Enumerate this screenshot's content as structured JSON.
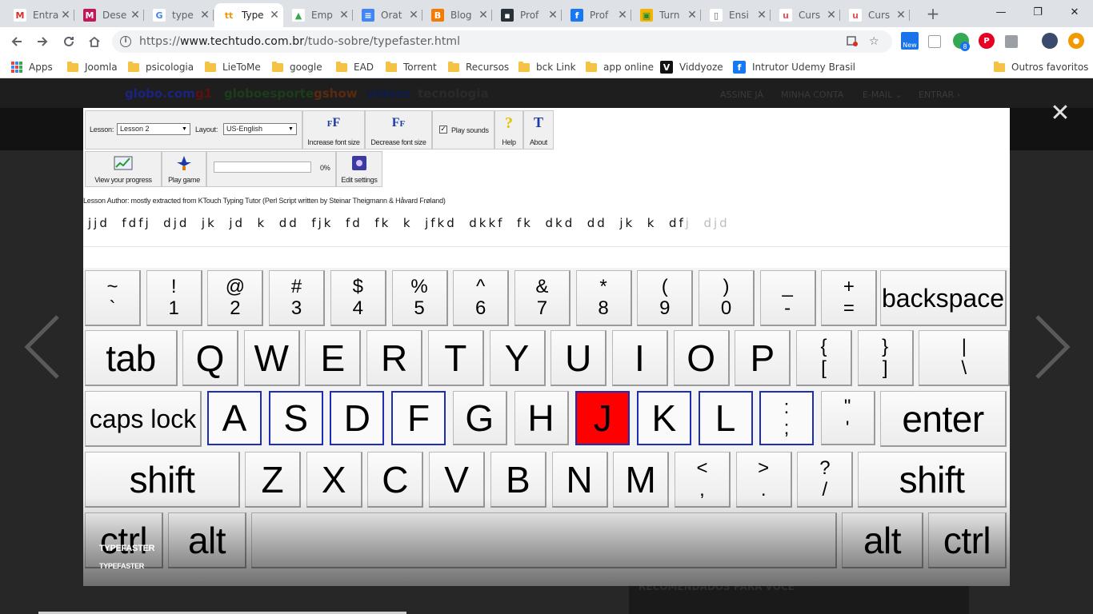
{
  "browser": {
    "tabs": [
      {
        "title": "Entra",
        "icon": "gmail-icon",
        "favicon_text": "M",
        "color": "#ffffff",
        "fg": "#d93025"
      },
      {
        "title": "Dese",
        "icon": "mendeley-icon",
        "favicon_text": "M",
        "color": "#c2185b",
        "fg": "#ffffff"
      },
      {
        "title": "type",
        "icon": "google-icon",
        "favicon_text": "G",
        "color": "#ffffff",
        "fg": "#4285f4"
      },
      {
        "title": "Type",
        "icon": "techtudo-icon",
        "favicon_text": "tt",
        "color": "#ffffff",
        "fg": "#f29900",
        "active": true
      },
      {
        "title": "Emp",
        "icon": "drive-icon",
        "favicon_text": "▲",
        "color": "#ffffff",
        "fg": "#34a853"
      },
      {
        "title": "Orat",
        "icon": "docs-icon",
        "favicon_text": "≡",
        "color": "#4285f4",
        "fg": "#ffffff"
      },
      {
        "title": "Blog",
        "icon": "blogger-icon",
        "favicon_text": "B",
        "color": "#f57c00",
        "fg": "#ffffff"
      },
      {
        "title": "Prof",
        "icon": "classroom-board-icon",
        "favicon_text": "▪",
        "color": "#263238",
        "fg": "#ffffff"
      },
      {
        "title": "Prof",
        "icon": "facebook-icon",
        "favicon_text": "f",
        "color": "#1877f2",
        "fg": "#ffffff"
      },
      {
        "title": "Turn",
        "icon": "classroom-icon",
        "favicon_text": "▣",
        "color": "#f4b400",
        "fg": "#1e8e3e"
      },
      {
        "title": "Ensi",
        "icon": "page-icon",
        "favicon_text": "▯",
        "color": "#ffffff",
        "fg": "#5f6368"
      },
      {
        "title": "Curs",
        "icon": "udemy-icon",
        "favicon_text": "u",
        "color": "#ffffff",
        "fg": "#ec5252"
      },
      {
        "title": "Curs",
        "icon": "udemy-icon",
        "favicon_text": "u",
        "color": "#ffffff",
        "fg": "#ec5252"
      }
    ],
    "new_tab": "+",
    "window_controls": {
      "minimize": "—",
      "maximize": "❐",
      "close": "✕"
    },
    "url": {
      "scheme": "https://",
      "host": "www.techtudo.com.br",
      "path": "/tudo-sobre/typefaster.html"
    },
    "extension_badges": {
      "new": "New",
      "count": "8"
    },
    "bookmarks": [
      {
        "label": "Apps",
        "kind": "apps"
      },
      {
        "label": "Joomla",
        "kind": "folder"
      },
      {
        "label": "psicologia",
        "kind": "folder"
      },
      {
        "label": "LieToMe",
        "kind": "folder"
      },
      {
        "label": "google",
        "kind": "folder"
      },
      {
        "label": "EAD",
        "kind": "folder"
      },
      {
        "label": "Torrent",
        "kind": "folder"
      },
      {
        "label": "Recursos",
        "kind": "folder"
      },
      {
        "label": "bck Link",
        "kind": "folder"
      },
      {
        "label": "app online",
        "kind": "folder"
      },
      {
        "label": "Viddyoze",
        "kind": "viddyoze"
      },
      {
        "label": "Intrutor Udemy Brasil",
        "kind": "facebook"
      }
    ],
    "other_bookmarks": "Outros favoritos"
  },
  "page": {
    "globo_links": [
      {
        "label": "globo.com",
        "color": "#1a237e"
      },
      {
        "label": "g1",
        "color": "#5d1010"
      },
      {
        "label": "globoesporte",
        "color": "#1b3d1b"
      },
      {
        "label": "gshow",
        "color": "#5a2a10"
      },
      {
        "label": "vídeos",
        "color": "#0d1b4a"
      },
      {
        "label": "tecnologia",
        "color": "#2a2a2a"
      }
    ],
    "account_links": [
      "ASSINE JÁ",
      "MINHA CONTA",
      "E-MAIL ⌄",
      "ENTRAR ›"
    ],
    "recommended": "RECOMENDADOS PARA VOCÊ",
    "close_symbol": "✕"
  },
  "typefaster": {
    "lesson_label": "Lesson:",
    "lesson_value": "Lesson 2",
    "layout_label": "Layout:",
    "layout_value": "US-English",
    "increase_font": "Increase font size",
    "decrease_font": "Decrease font size",
    "play_sounds": "Play sounds",
    "help": "Help",
    "about": "About",
    "view_progress": "View your progress",
    "play_game": "Play game",
    "progress_percent": "0%",
    "progress_value": 0,
    "edit_settings": "Edit settings",
    "author": "Lesson Author: mostly extracted from KTouch Typing Tutor (Perl Script written by Steinar Theigmann & Håvard Frøland)",
    "lesson_typed": "jjd  fdfj  djd  jk  jd  k  dd  fjk  fd  fk  k  jfkd  dkkf  fk  dkd  dd  jk  k  df",
    "lesson_rest": "j  djd",
    "caption_title": "TYPEFASTER",
    "caption_sub": "TYPEFASTER"
  },
  "keyboard": {
    "active_color": "#ff0000",
    "home_border_color": "#1d2db5",
    "row1": [
      [
        "~",
        "`"
      ],
      [
        "!",
        "1"
      ],
      [
        "@",
        "2"
      ],
      [
        "#",
        "3"
      ],
      [
        "$",
        "4"
      ],
      [
        "%",
        "5"
      ],
      [
        "^",
        "6"
      ],
      [
        "&",
        "7"
      ],
      [
        "*",
        "8"
      ],
      [
        "(",
        "9"
      ],
      [
        ")",
        "0"
      ],
      [
        "_",
        "-"
      ],
      [
        "+",
        "="
      ]
    ],
    "backspace": "backspace",
    "tab": "tab",
    "row2": [
      "Q",
      "W",
      "E",
      "R",
      "T",
      "Y",
      "U",
      "I",
      "O",
      "P"
    ],
    "row2_sym": [
      [
        "{",
        "["
      ],
      [
        "}",
        "]"
      ],
      [
        "|",
        "\\"
      ]
    ],
    "caps_lock": "caps lock",
    "row3": [
      "A",
      "S",
      "D",
      "F",
      "G",
      "H",
      "J",
      "K",
      "L"
    ],
    "row3_sym": [
      [
        ":",
        ";"
      ],
      [
        "\"",
        "'"
      ]
    ],
    "enter": "enter",
    "shift_left": "shift",
    "row4": [
      "Z",
      "X",
      "C",
      "V",
      "B",
      "N",
      "M"
    ],
    "row4_sym": [
      [
        "<",
        ","
      ],
      [
        ">",
        "."
      ],
      [
        "?",
        "/"
      ]
    ],
    "shift_right": "shift",
    "ctrl_left": "ctrl",
    "alt_left": "alt",
    "alt_right": "alt",
    "ctrl_right": "ctrl",
    "active_key": "J"
  }
}
